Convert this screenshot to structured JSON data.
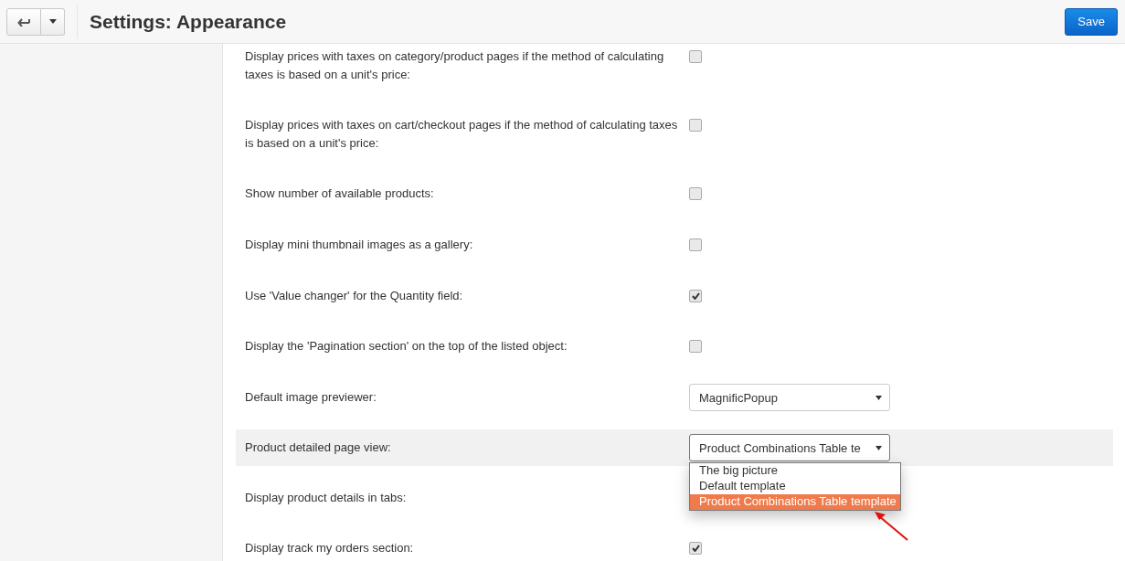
{
  "toolbar": {
    "title": "Settings: Appearance",
    "save_button": "Save"
  },
  "settings": [
    {
      "kind": "checkbox",
      "label": "Display prices with taxes on category/product pages if the method of calculating taxes is based on a unit's price:",
      "checked": false
    },
    {
      "kind": "checkbox",
      "label": "Display prices with taxes on cart/checkout pages if the method of calculating taxes is based on a unit's price:",
      "checked": false
    },
    {
      "kind": "checkbox",
      "label": "Show number of available products:",
      "checked": false
    },
    {
      "kind": "checkbox",
      "label": "Display mini thumbnail images as a gallery:",
      "checked": false
    },
    {
      "kind": "checkbox",
      "label": "Use 'Value changer' for the Quantity field:",
      "checked": true
    },
    {
      "kind": "checkbox",
      "label": "Display the 'Pagination section' on the top of the listed object:",
      "checked": false
    },
    {
      "kind": "select",
      "label": "Default image previewer:",
      "value": "MagnificPopup",
      "highlighted": false,
      "expanded": false
    },
    {
      "kind": "select",
      "label": "Product detailed page view:",
      "value": "Product Combinations Table te",
      "highlighted": true,
      "expanded": true,
      "options": [
        {
          "label": "The big picture",
          "selected": false
        },
        {
          "label": "Default template",
          "selected": false
        },
        {
          "label": "Product Combinations Table template",
          "selected": true
        }
      ]
    },
    {
      "kind": "checkbox",
      "label": "Display product details in tabs:"
    },
    {
      "kind": "checkbox",
      "label": "Display track my orders section:",
      "checked": true
    }
  ]
}
